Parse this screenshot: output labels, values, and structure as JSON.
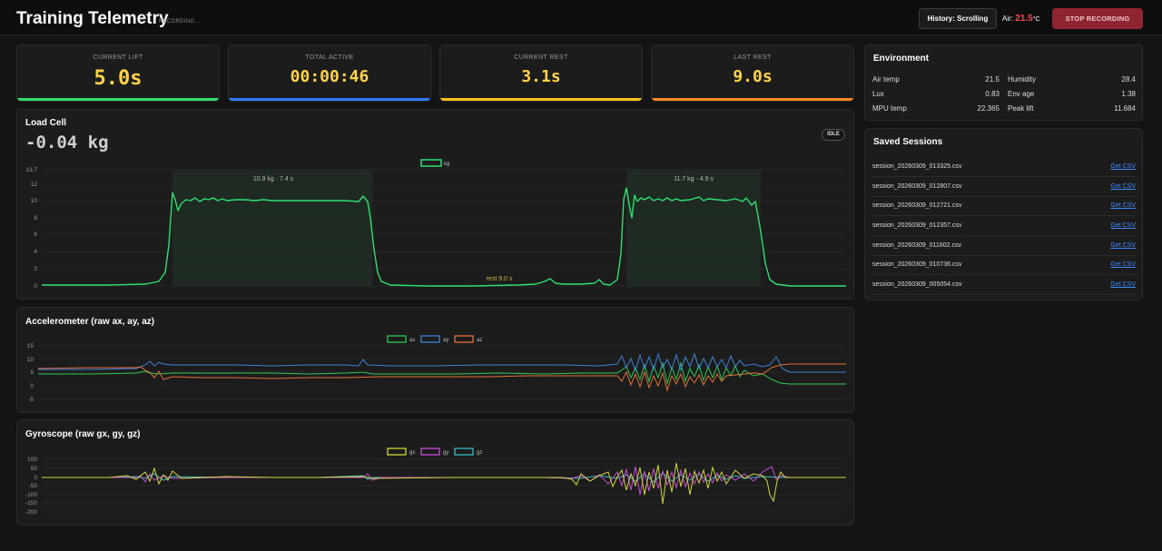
{
  "header": {
    "title": "Training Telemetry",
    "recording_status": "RECORDING...",
    "history_button": "History: Scrolling",
    "air_label": "Air:",
    "air_value": "21.5",
    "air_unit": "°C",
    "stop_button": "STOP RECORDING"
  },
  "stats": [
    {
      "label": "CURRENT LIFT",
      "value": "5.0s",
      "color": "#2ee06f"
    },
    {
      "label": "TOTAL ACTIVE",
      "value": "00:00:46",
      "color": "#2f7bff"
    },
    {
      "label": "CURRENT REST",
      "value": "3.1s",
      "color": "#ffc21a"
    },
    {
      "label": "LAST REST",
      "value": "9.0s",
      "color": "#ff8a1f"
    }
  ],
  "load_cell": {
    "title": "Load Cell",
    "value": "-0.04 kg",
    "status_badge": "IDLE",
    "legend": "kg",
    "y_ticks": [
      "13.7",
      "12",
      "10",
      "8",
      "6",
      "4",
      "2",
      "0"
    ],
    "annotations": [
      "10.9 kg · 7.4 s",
      "11.7 kg · 4.9 s",
      "rest 9.0 s"
    ]
  },
  "accelerometer": {
    "title": "Accelerometer (raw ax, ay, az)",
    "y_ticks": [
      "15",
      "10",
      "5",
      "0",
      "-5"
    ],
    "legend": [
      "ax",
      "ay",
      "az"
    ]
  },
  "gyroscope": {
    "title": "Gyroscope (raw gx, gy, gz)",
    "y_ticks": [
      "100",
      "50",
      "0",
      "-50",
      "-100",
      "-150",
      "-200"
    ],
    "legend": [
      "gx",
      "gy",
      "gz"
    ]
  },
  "environment": {
    "title": "Environment",
    "left": [
      {
        "label": "Air temp",
        "value": "21.5"
      },
      {
        "label": "Lux",
        "value": "0.83"
      },
      {
        "label": "MPU temp",
        "value": "22.365"
      }
    ],
    "right": [
      {
        "label": "Humidity",
        "value": "28.4"
      },
      {
        "label": "Env age",
        "value": "1.38"
      },
      {
        "label": "Peak lift",
        "value": "11.684"
      }
    ]
  },
  "saved_sessions": {
    "title": "Saved Sessions",
    "link_label": "Get CSV",
    "files": [
      "session_20260309_013325.csv",
      "session_20260309_012807.csv",
      "session_20260309_012721.csv",
      "session_20260309_012357.csv",
      "session_20260309_011602.csv",
      "session_20260309_010736.csv",
      "session_20260309_005054.csv"
    ]
  },
  "colors": {
    "kg": "#2ee06f",
    "ax": "#2ec74f",
    "ay": "#3d82d6",
    "az": "#e0703a",
    "gx": "#d4d43a",
    "gy": "#c84bd4",
    "gz": "#3ab8c4"
  }
}
